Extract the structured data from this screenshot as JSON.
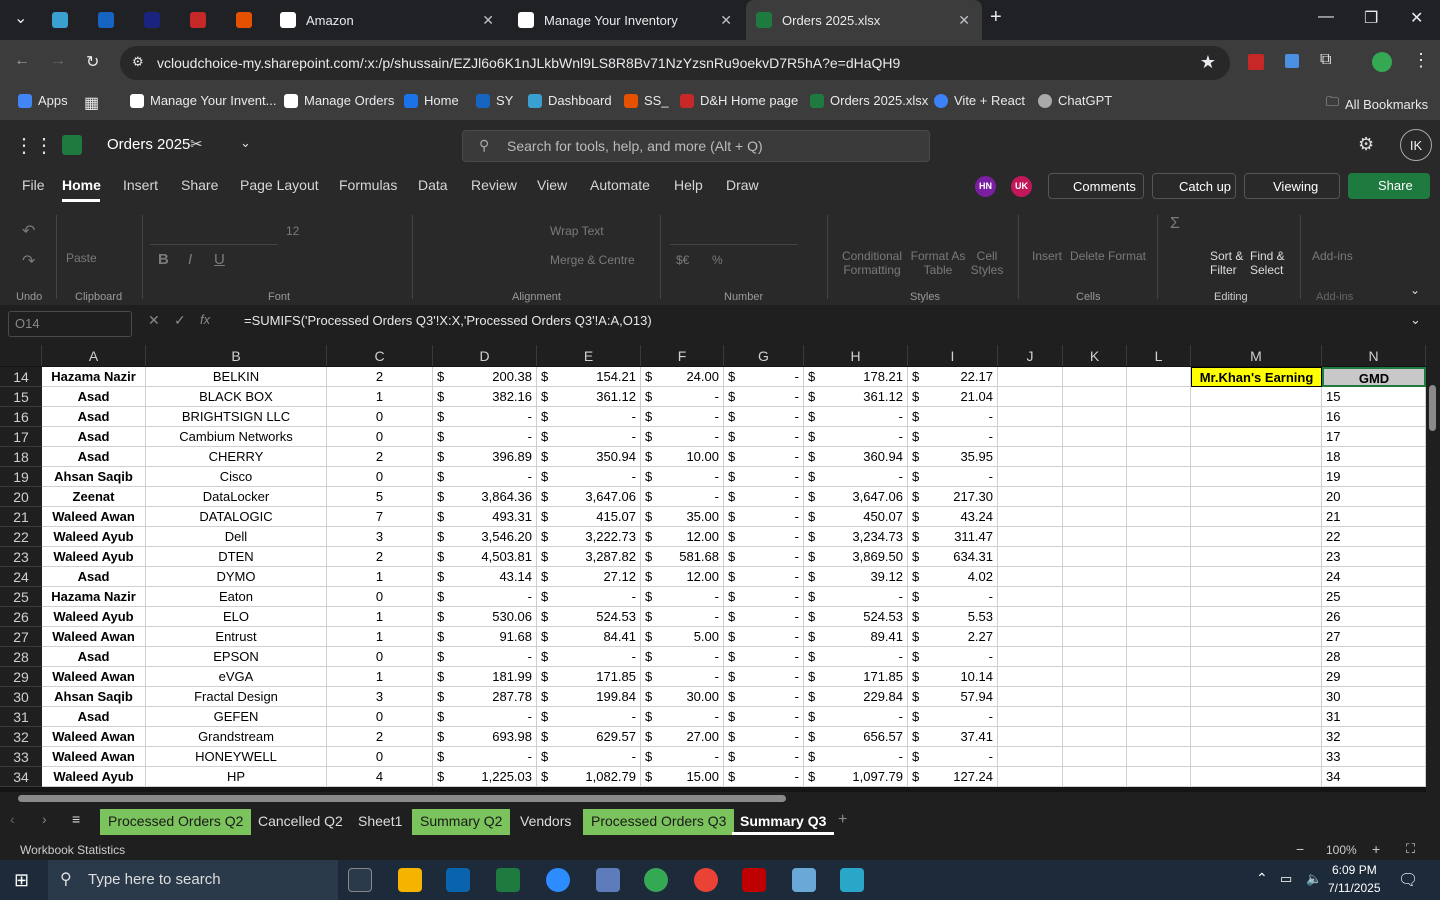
{
  "browser": {
    "tabs": [
      {
        "label": "Amazon"
      },
      {
        "label": "Manage Your Inventory"
      },
      {
        "label": "Orders 2025.xlsx"
      }
    ],
    "url": "vcloudchoice-my.sharepoint.com/:x:/p/shussain/EZJl6o6K1nJLkbWnl9LS8R8Bv71NzYzsnRu9oekvD7R5hA?e=dHaQH9",
    "bookmarks": [
      {
        "label": "Apps",
        "color": "#4285f4"
      },
      {
        "label": "Manage Your Invent...",
        "color": "#ffffff"
      },
      {
        "label": "Manage Orders",
        "color": "#ffffff"
      },
      {
        "label": "Home",
        "color": "#1a73e8"
      },
      {
        "label": "SY",
        "color": "#1565c0"
      },
      {
        "label": "Dashboard",
        "color": "#3aa0d0"
      },
      {
        "label": "SS_",
        "color": "#e65100"
      },
      {
        "label": "D&H Home page",
        "color": "#c62828"
      },
      {
        "label": "Orders 2025.xlsx",
        "color": "#1e7a3f"
      },
      {
        "label": "Vite + React",
        "color": "#3b82f6"
      },
      {
        "label": "ChatGPT",
        "color": "#aaaaaa"
      }
    ],
    "all_bookmarks": "All Bookmarks"
  },
  "excel": {
    "doc_title": "Orders 2025",
    "search_placeholder": "Search for tools, help, and more (Alt + Q)",
    "user_initials": "IK",
    "menus": [
      "File",
      "Home",
      "Insert",
      "Share",
      "Page Layout",
      "Formulas",
      "Data",
      "Review",
      "View",
      "Automate",
      "Help",
      "Draw"
    ],
    "presence": [
      "HN",
      "UK"
    ],
    "comments": "Comments",
    "catchup": "Catch up",
    "viewing": "Viewing",
    "share": "Share",
    "ribbon": {
      "undo": "Undo",
      "paste": "Paste",
      "clipboard": "Clipboard",
      "font_size": "12",
      "font": "Font",
      "wrap": "Wrap Text",
      "merge": "Merge & Centre",
      "alignment": "Alignment",
      "number": "Number",
      "cond": "Conditional Formatting",
      "formatas": "Format As Table",
      "cellstyles": "Cell Styles",
      "styles": "Styles",
      "insert": "Insert",
      "delete": "Delete",
      "format": "Format",
      "cells": "Cells",
      "sort": "Sort & Filter",
      "find": "Find & Select",
      "editing": "Editing",
      "addins": "Add-ins"
    },
    "name_box": "O14",
    "formula": "=SUMIFS('Processed Orders Q3'!X:X,'Processed Orders Q3'!A:A,O13)",
    "columns": [
      "A",
      "B",
      "C",
      "D",
      "E",
      "F",
      "G",
      "H",
      "I",
      "J",
      "K",
      "L",
      "M",
      "N"
    ],
    "rows": [
      {
        "n": "14",
        "a": "Hazama Nazir",
        "b": "BELKIN",
        "c": "2",
        "d": "200.38",
        "e": "154.21",
        "f": "24.00",
        "g": "-",
        "h": "178.21",
        "i": "22.17"
      },
      {
        "n": "15",
        "a": "Asad",
        "b": "BLACK BOX",
        "c": "1",
        "d": "382.16",
        "e": "361.12",
        "f": "-",
        "g": "-",
        "h": "361.12",
        "i": "21.04"
      },
      {
        "n": "16",
        "a": "Asad",
        "b": "BRIGHTSIGN LLC",
        "c": "0",
        "d": "-",
        "e": "-",
        "f": "-",
        "g": "-",
        "h": "-",
        "i": "-"
      },
      {
        "n": "17",
        "a": "Asad",
        "b": "Cambium Networks",
        "c": "0",
        "d": "-",
        "e": "-",
        "f": "-",
        "g": "-",
        "h": "-",
        "i": "-"
      },
      {
        "n": "18",
        "a": "Asad",
        "b": "CHERRY",
        "c": "2",
        "d": "396.89",
        "e": "350.94",
        "f": "10.00",
        "g": "-",
        "h": "360.94",
        "i": "35.95"
      },
      {
        "n": "19",
        "a": "Ahsan Saqib",
        "b": "Cisco",
        "c": "0",
        "d": "-",
        "e": "-",
        "f": "-",
        "g": "-",
        "h": "-",
        "i": "-"
      },
      {
        "n": "20",
        "a": "Zeenat",
        "b": "DataLocker",
        "c": "5",
        "d": "3,864.36",
        "e": "3,647.06",
        "f": "-",
        "g": "-",
        "h": "3,647.06",
        "i": "217.30"
      },
      {
        "n": "21",
        "a": "Waleed Awan",
        "b": "DATALOGIC",
        "c": "7",
        "d": "493.31",
        "e": "415.07",
        "f": "35.00",
        "g": "-",
        "h": "450.07",
        "i": "43.24"
      },
      {
        "n": "22",
        "a": "Waleed Ayub",
        "b": "Dell",
        "c": "3",
        "d": "3,546.20",
        "e": "3,222.73",
        "f": "12.00",
        "g": "-",
        "h": "3,234.73",
        "i": "311.47"
      },
      {
        "n": "23",
        "a": "Waleed Ayub",
        "b": "DTEN",
        "c": "2",
        "d": "4,503.81",
        "e": "3,287.82",
        "f": "581.68",
        "g": "-",
        "h": "3,869.50",
        "i": "634.31"
      },
      {
        "n": "24",
        "a": "Asad",
        "b": "DYMO",
        "c": "1",
        "d": "43.14",
        "e": "27.12",
        "f": "12.00",
        "g": "-",
        "h": "39.12",
        "i": "4.02"
      },
      {
        "n": "25",
        "a": "Hazama Nazir",
        "b": "Eaton",
        "c": "0",
        "d": "-",
        "e": "-",
        "f": "-",
        "g": "-",
        "h": "-",
        "i": "-"
      },
      {
        "n": "26",
        "a": "Waleed Ayub",
        "b": "ELO",
        "c": "1",
        "d": "530.06",
        "e": "524.53",
        "f": "-",
        "g": "-",
        "h": "524.53",
        "i": "5.53"
      },
      {
        "n": "27",
        "a": "Waleed Awan",
        "b": "Entrust",
        "c": "1",
        "d": "91.68",
        "e": "84.41",
        "f": "5.00",
        "g": "-",
        "h": "89.41",
        "i": "2.27"
      },
      {
        "n": "28",
        "a": "Asad",
        "b": "EPSON",
        "c": "0",
        "d": "-",
        "e": "-",
        "f": "-",
        "g": "-",
        "h": "-",
        "i": "-"
      },
      {
        "n": "29",
        "a": "Waleed Awan",
        "b": "eVGA",
        "c": "1",
        "d": "181.99",
        "e": "171.85",
        "f": "-",
        "g": "-",
        "h": "171.85",
        "i": "10.14"
      },
      {
        "n": "30",
        "a": "Ahsan Saqib",
        "b": "Fractal Design",
        "c": "3",
        "d": "287.78",
        "e": "199.84",
        "f": "30.00",
        "g": "-",
        "h": "229.84",
        "i": "57.94"
      },
      {
        "n": "31",
        "a": "Asad",
        "b": "GEFEN",
        "c": "0",
        "d": "-",
        "e": "-",
        "f": "-",
        "g": "-",
        "h": "-",
        "i": "-"
      },
      {
        "n": "32",
        "a": "Waleed Awan",
        "b": "Grandstream",
        "c": "2",
        "d": "693.98",
        "e": "629.57",
        "f": "27.00",
        "g": "-",
        "h": "656.57",
        "i": "37.41"
      },
      {
        "n": "33",
        "a": "Waleed Awan",
        "b": "HONEYWELL",
        "c": "0",
        "d": "-",
        "e": "-",
        "f": "-",
        "g": "-",
        "h": "-",
        "i": "-"
      },
      {
        "n": "34",
        "a": "Waleed Ayub",
        "b": "HP",
        "c": "4",
        "d": "1,225.03",
        "e": "1,082.79",
        "f": "15.00",
        "g": "-",
        "h": "1,097.79",
        "i": "127.24"
      }
    ],
    "currency": "$",
    "m_header": "Mr.Khan's Earning",
    "n_header": "GMD",
    "sheets": [
      {
        "label": "Processed Orders Q2",
        "green": true
      },
      {
        "label": "Cancelled Q2",
        "green": false
      },
      {
        "label": "Sheet1",
        "green": false
      },
      {
        "label": "Summary Q2",
        "green": true
      },
      {
        "label": "Vendors",
        "green": false
      },
      {
        "label": "Processed Orders Q3",
        "green": true
      },
      {
        "label": "Summary Q3",
        "green": false,
        "active": true
      }
    ],
    "status_left": "Workbook Statistics",
    "zoom": "100%"
  },
  "taskbar": {
    "search": "Type here to search",
    "time": "6:09 PM",
    "date": "7/11/2025"
  }
}
